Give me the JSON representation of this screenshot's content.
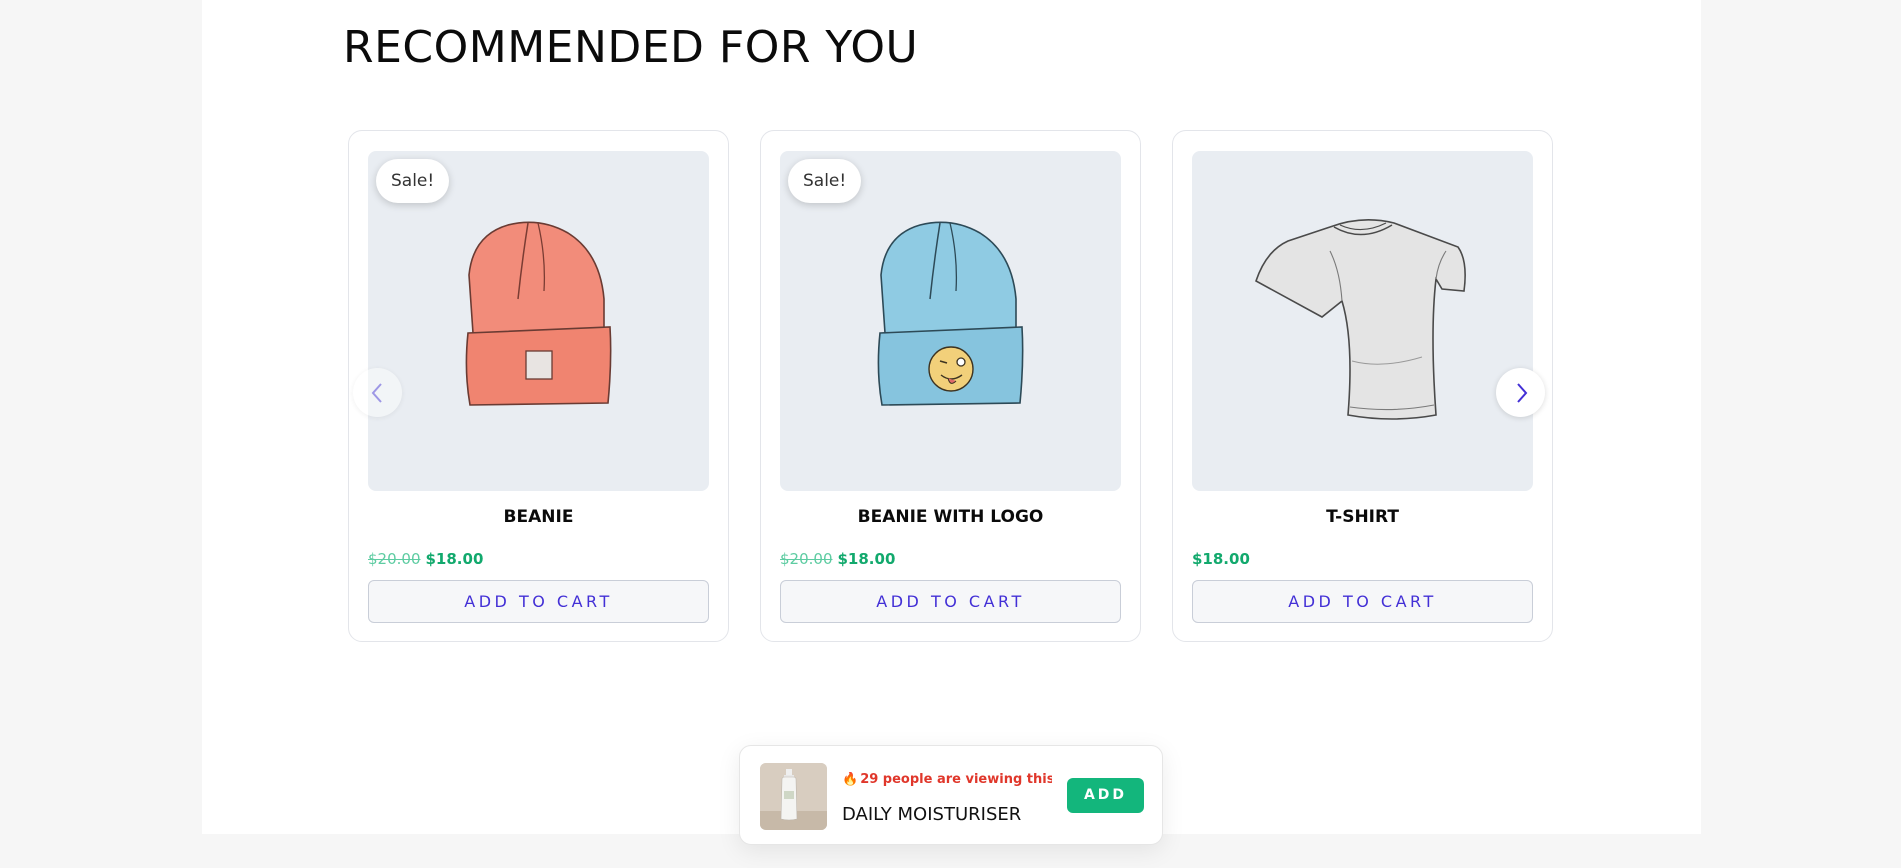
{
  "section": {
    "title": "RECOMMENDED FOR YOU"
  },
  "products": [
    {
      "name": "BEANIE",
      "sale_badge": "Sale!",
      "regular_price": "$20.00",
      "sale_price": "$18.00",
      "button_label": "ADD TO CART",
      "image": "beanie-icon",
      "image_color": "#f28c7a"
    },
    {
      "name": "BEANIE WITH LOGO",
      "sale_badge": "Sale!",
      "regular_price": "$20.00",
      "sale_price": "$18.00",
      "button_label": "ADD TO CART",
      "image": "beanie-with-logo-icon",
      "image_color": "#8fcbe3"
    },
    {
      "name": "T-SHIRT",
      "sale_badge": "",
      "regular_price": "",
      "sale_price": "$18.00",
      "button_label": "ADD TO CART",
      "image": "t-shirt-icon",
      "image_color": "#e4e4e4"
    }
  ],
  "carousel": {
    "prev_icon": "chevron-left-icon",
    "next_icon": "chevron-right-icon"
  },
  "sticky_bar": {
    "viewing_text": "29 people are viewing this ...",
    "viewing_icon": "fire-icon",
    "product_name": "DAILY MOISTURISER",
    "add_label": "ADD"
  },
  "colors": {
    "accent": "#4330d6",
    "price": "#12a96d",
    "add_button": "#13b67c",
    "viewing_text": "#e0372b"
  }
}
